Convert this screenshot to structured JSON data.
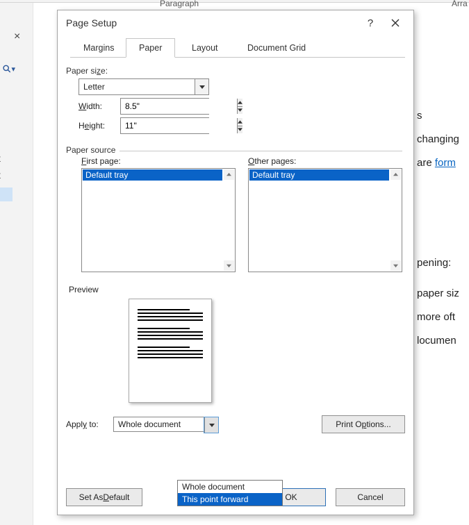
{
  "ribbon": {
    "group1": "Paragraph",
    "group2": "Arra"
  },
  "doc": {
    "frag0": "s",
    "frag1": "changing",
    "frag2a": "are ",
    "frag2b": "form",
    "frag3": "pening:",
    "frag4": "paper siz",
    "frag5": "more oft",
    "frag6": "locumen",
    "left": {
      "t1": "t",
      "t2": "t"
    }
  },
  "dialog": {
    "title": "Page Setup",
    "tabs": {
      "margins": "Margins",
      "paper": "Paper",
      "layout": "Layout",
      "grid": "Document Grid"
    },
    "paper_size_label": "Paper size:",
    "paper_size_value": "Letter",
    "width_label": "Width:",
    "width_value": "8.5\"",
    "height_label": "Height:",
    "height_value": "11\"",
    "paper_source_label": "Paper source",
    "first_page_label": "First page:",
    "other_pages_label": "Other pages:",
    "tray_option": "Default tray",
    "preview_label": "Preview",
    "apply_to_label": "Apply to:",
    "apply_to_value": "Whole document",
    "apply_options": [
      "Whole document",
      "This point forward"
    ],
    "print_options": "Print Options...",
    "set_default": "Set As Default",
    "ok": "OK",
    "cancel": "Cancel"
  }
}
